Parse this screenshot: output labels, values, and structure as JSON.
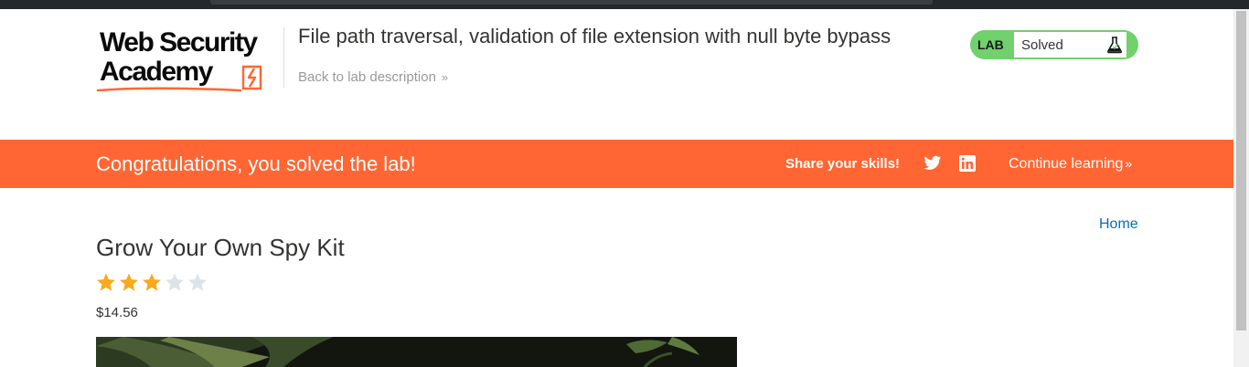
{
  "header": {
    "logo_line1": "Web Security",
    "logo_line2": "Academy",
    "lab_title": "File path traversal, validation of file extension with null byte bypass",
    "back_link": "Back to lab description",
    "back_chevron": "»",
    "status_badge_label": "LAB",
    "status_value": "Solved"
  },
  "banner": {
    "message": "Congratulations, you solved the lab!",
    "share_label": "Share your skills!",
    "continue_label": "Continue learning",
    "continue_chevron": "»"
  },
  "nav": {
    "home_label": "Home"
  },
  "product": {
    "title": "Grow Your Own Spy Kit",
    "rating": 3,
    "rating_max": 5,
    "price": "$14.56"
  },
  "colors": {
    "accent": "#ff6633",
    "status_green": "#70d16d",
    "link_blue": "#0071bc",
    "star_filled": "#f9a91a",
    "star_empty": "#dde3e6"
  },
  "icons": {
    "twitter": "twitter-icon",
    "linkedin": "linkedin-icon",
    "flask": "flask-icon"
  }
}
